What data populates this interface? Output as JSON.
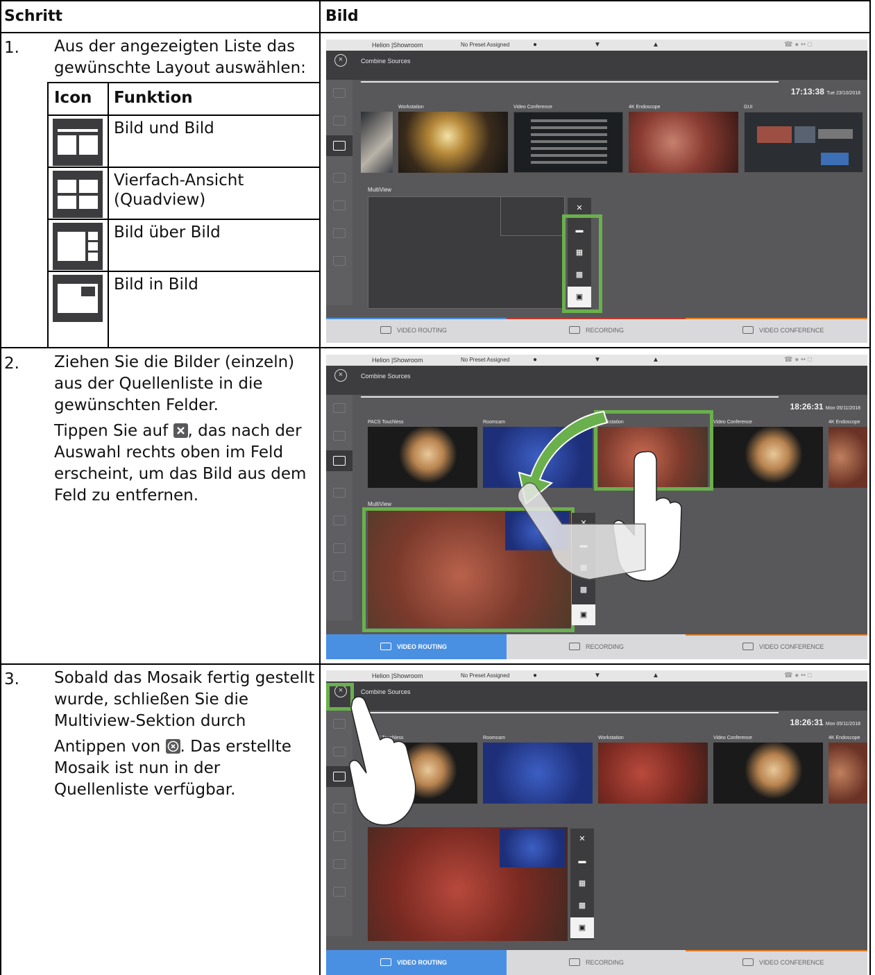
{
  "table": {
    "col1_header": "Schritt",
    "col2_header": "Bild"
  },
  "steps": [
    {
      "number": "1.",
      "text": "Aus der angezeigten Liste das gewünschte Layout auswählen:",
      "subtable": {
        "header_icon": "Icon",
        "header_function": "Funktion",
        "rows": [
          {
            "icon": "layout-side-by-side-icon",
            "function": "Bild und Bild"
          },
          {
            "icon": "layout-quadview-icon",
            "function": "Vierfach-Ansicht (Quadview)"
          },
          {
            "icon": "layout-picture-over-picture-icon",
            "function": "Bild über Bild"
          },
          {
            "icon": "layout-picture-in-picture-icon",
            "function": "Bild in Bild"
          }
        ]
      }
    },
    {
      "number": "2.",
      "text_a": "Ziehen Sie die Bilder (einzeln) aus der Quellenliste in die gewünschten Felder.",
      "text_b_before": "Tippen Sie auf",
      "text_b_after": ", das nach der Auswahl rechts oben im Feld erscheint, um das Bild aus dem Feld zu entfernen."
    },
    {
      "number": "3.",
      "text_a": "Sobald das Mosaik fertig gestellt wurde, schließen Sie die Multiview-Sektion durch",
      "text_b_before": "Antippen von",
      "text_b_after": ". Das erstellte Mosaik ist nun in der Quellenliste verfügbar."
    }
  ],
  "screens": [
    {
      "app_name": "Helion |Showroom",
      "preset": "No Preset Assigned",
      "title": "Combine Sources",
      "time": "17:13:38",
      "date": "Tue 23/10/2018",
      "sources": [
        "Workstation",
        "Video Conference",
        "4K Endoscope",
        "GUI"
      ],
      "multiview_label": "MultiView",
      "tabs": [
        "VIDEO ROUTING",
        "RECORDING",
        "VIDEO CONFERENCE"
      ]
    },
    {
      "app_name": "Helion |Showroom",
      "preset": "No Preset Assigned",
      "title": "Combine Sources",
      "time": "18:26:31",
      "date": "Mon 05/11/2018",
      "sources": [
        "PACS Touchless",
        "Roomcam",
        "Workstation",
        "Video Conference",
        "4K Endoscope"
      ],
      "multiview_label": "MultiView",
      "tabs": [
        "VIDEO ROUTING",
        "RECORDING",
        "VIDEO CONFERENCE"
      ]
    },
    {
      "app_name": "Helion |Showroom",
      "preset": "No Preset Assigned",
      "title": "Combine Sources",
      "time": "18:26:31",
      "date": "Mon 05/11/2018",
      "sources": [
        "PACS Touchless",
        "Roomcam",
        "Workstation",
        "Video Conference",
        "4K Endoscope"
      ],
      "multiview_label": "Multi",
      "tabs": [
        "VIDEO ROUTING",
        "RECORDING",
        "VIDEO CONFERENCE"
      ]
    }
  ],
  "colors": {
    "highlight_green": "#6ab04c",
    "active_tab_blue": "#4a90e2",
    "panel_gray": "#58585b"
  }
}
